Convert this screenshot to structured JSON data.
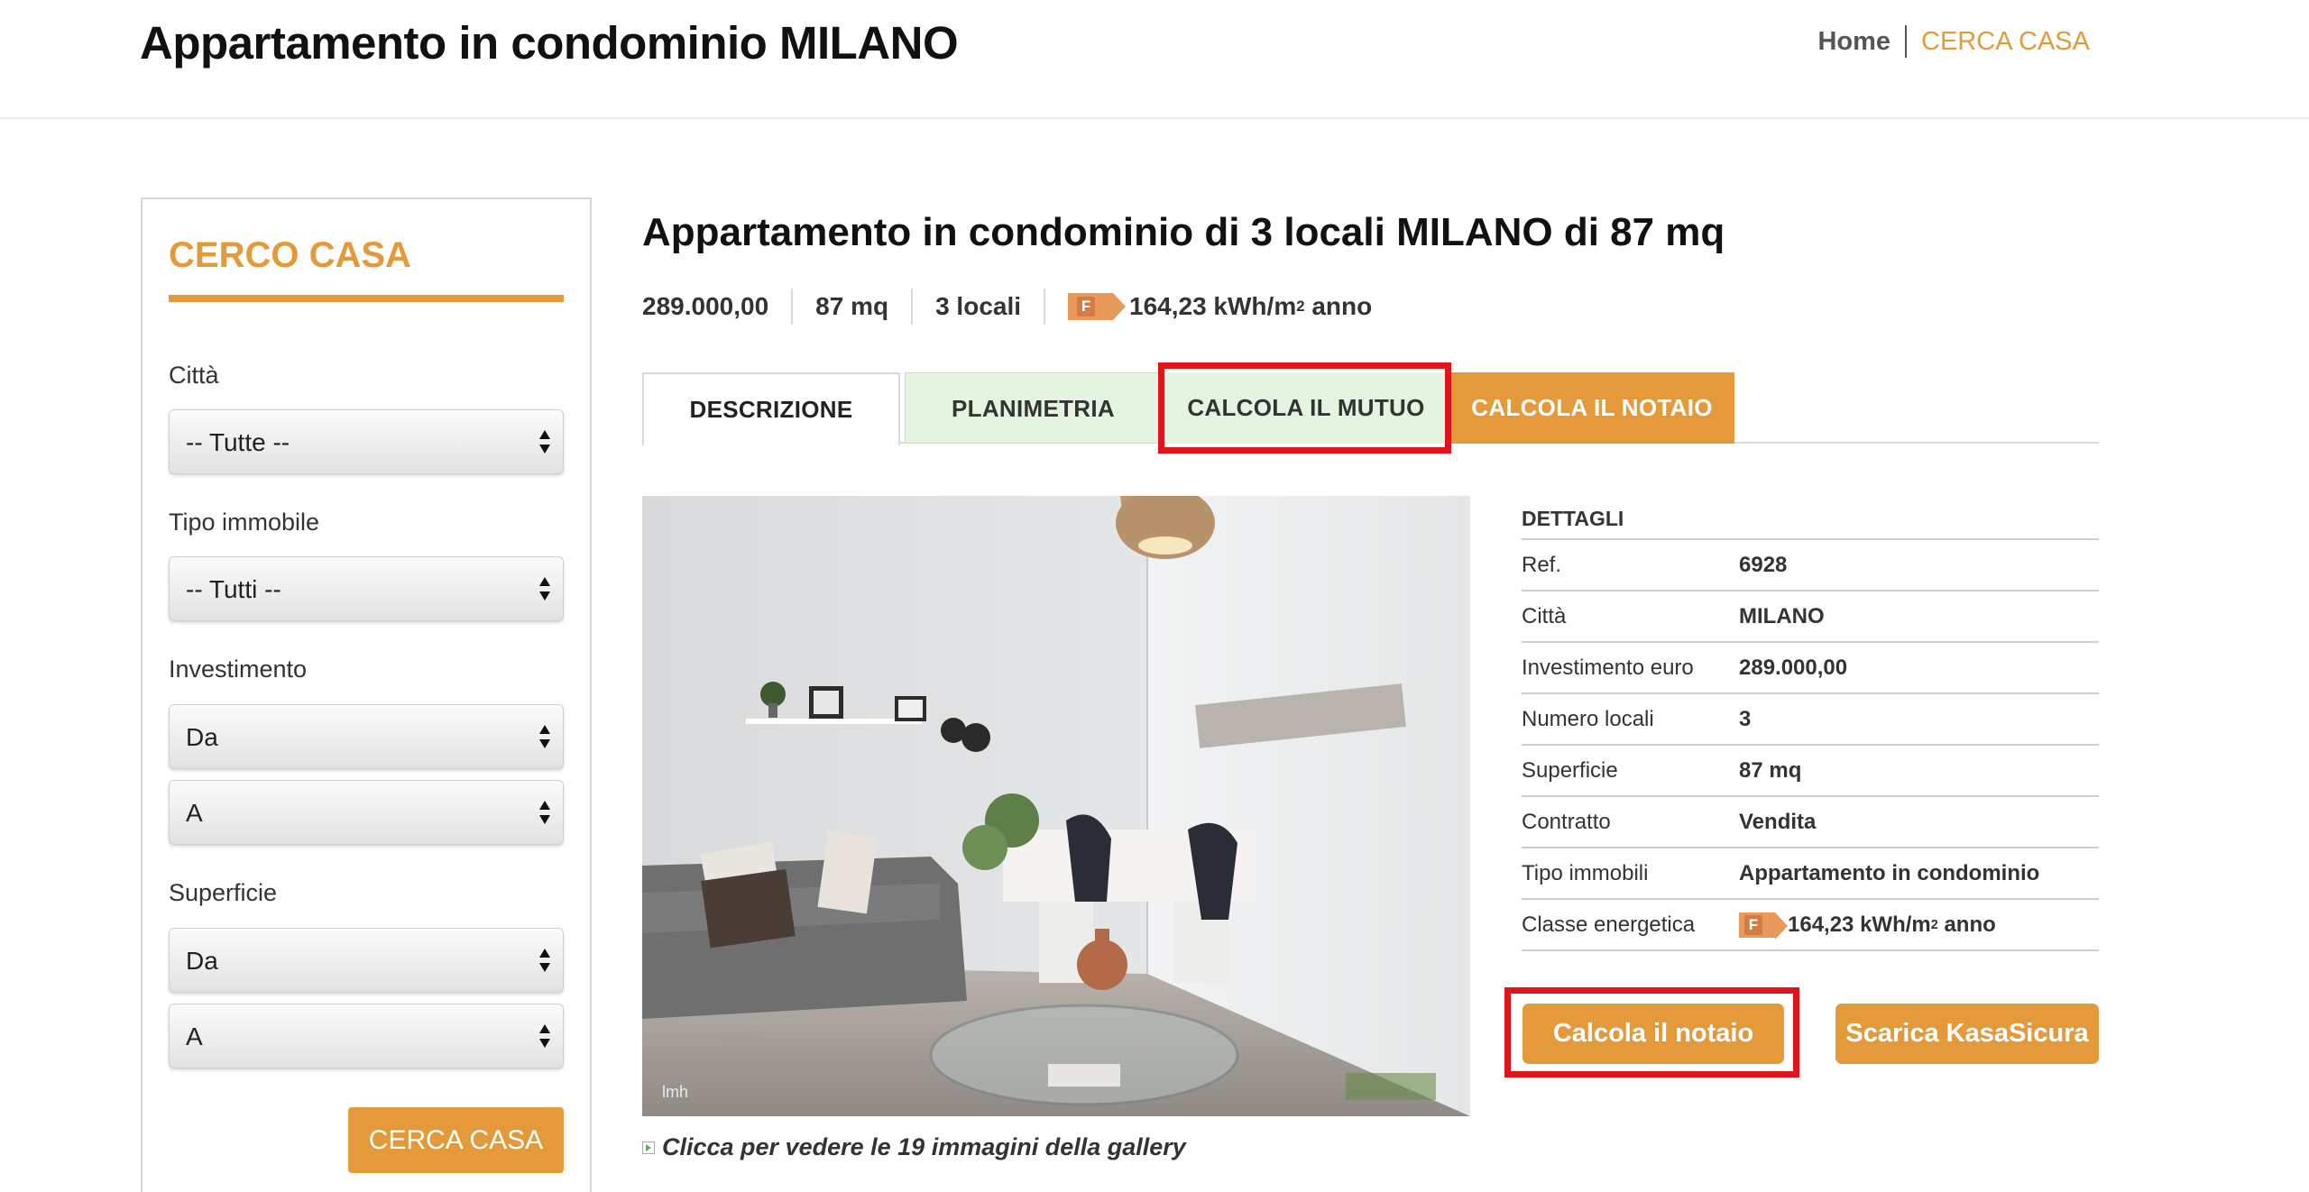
{
  "header": {
    "site_title": "Appartamento in condominio MILANO",
    "nav_home": "Home",
    "nav_cerca": "CERCA CASA"
  },
  "sidebar": {
    "title": "CERCO CASA",
    "citta_label": "Città",
    "citta_value": "-- Tutte --",
    "tipo_label": "Tipo immobile",
    "tipo_value": "-- Tutti --",
    "investimento_label": "Investimento",
    "investimento_da": "Da",
    "investimento_a": "A",
    "superficie_label": "Superficie",
    "superficie_da": "Da",
    "superficie_a": "A",
    "button": "CERCA CASA"
  },
  "listing": {
    "title": "Appartamento in condominio di 3 locali MILANO di 87 mq",
    "price": "289.000,00",
    "area": "87 mq",
    "rooms": "3 locali",
    "energy_class": "F",
    "energy_value": "164,23 kWh/m",
    "energy_exp": "2",
    "energy_unit": "anno"
  },
  "tabs": {
    "descrizione": "DESCRIZIONE",
    "planimetria": "PLANIMETRIA",
    "mutuo": "CALCOLA IL MUTUO",
    "notaio": "CALCOLA IL NOTAIO"
  },
  "gallery": {
    "link_text": "Clicca per vedere le 19 immagini della gallery",
    "watermark": "lmh"
  },
  "details": {
    "heading": "DETTAGLI",
    "rows": [
      {
        "k": "Ref.",
        "v": "6928"
      },
      {
        "k": "Città",
        "v": "MILANO"
      },
      {
        "k": "Investimento euro",
        "v": "289.000,00"
      },
      {
        "k": "Numero locali",
        "v": "3"
      },
      {
        "k": "Superficie",
        "v": "87 mq"
      },
      {
        "k": "Contratto",
        "v": "Vendita"
      },
      {
        "k": "Tipo immobili",
        "v": "Appartamento in condominio"
      }
    ],
    "energy_label": "Classe energetica",
    "energy_class": "F",
    "energy_value": "164,23 kWh/m",
    "energy_exp": "2",
    "energy_unit": "anno"
  },
  "actions": {
    "notaio": "Calcola il notaio",
    "kasasicura": "Scarica KasaSicura"
  },
  "colors": {
    "accent": "#e49a3b",
    "tab_green": "#e5f4e0",
    "highlight": "#e0141c",
    "energy_f": "#e79a5a"
  }
}
